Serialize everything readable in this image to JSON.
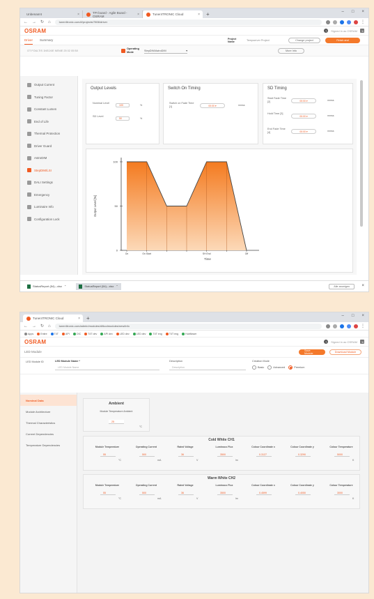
{
  "screen1": {
    "tabs": [
      {
        "label": "Unbenannt"
      },
      {
        "label": "TPI board - Agile Board - OSRAM"
      },
      {
        "label": "Tuner4TRONIC Cloud"
      }
    ],
    "url": "tuner4tronic.com/#/projects/7806/driver",
    "brand": "OSRAM",
    "signed_in": "Signed in as OSRAM",
    "subtabs": [
      "Driver",
      "Summary"
    ],
    "project_name_label": "Project Name",
    "project_name_value": "Tempserver Project",
    "change_project": "Change project",
    "finish": "Finish and",
    "device_id": "OT FOULTIS 1NS1XIE NENIE 25 02 05 BX",
    "operating_mode_label": "Operating Mode",
    "operating_mode_value": "StepDIM/AstroDIM",
    "more_info": "More Info",
    "sidebar": [
      "Output Current",
      "Tuning Factor",
      "Constant Lumen",
      "End of Life",
      "Thermal Protection",
      "Driver Guard",
      "AstroDIM",
      "StepDIM/LSI",
      "DALI Settings",
      "Emergency",
      "Luminaire Info",
      "Configuration Lock"
    ],
    "active_sidebar_index": 7,
    "output_levels": {
      "title": "Output Levels",
      "nominal_label": "Nominal Level",
      "nominal_value": "100",
      "nominal_unit": "%",
      "sd_label": "SD Level",
      "sd_value": "50",
      "sd_unit": "%"
    },
    "switch_on": {
      "title": "Switch On Timing",
      "label": "Switch on Fade Time [1]",
      "value": "00:00",
      "unit": "mmss"
    },
    "sd_timing": {
      "title": "SD Timing",
      "rows": [
        {
          "label": "Start Fade Time [2]",
          "value": "00:00",
          "unit": "mmss"
        },
        {
          "label": "Hold Time [3]",
          "value": "00:00",
          "unit": "mmss"
        },
        {
          "label": "End Fade Time [4]",
          "value": "00:00",
          "unit": "mmss"
        }
      ]
    },
    "downloads": [
      {
        "label": "StatusReport (54).-.xlsx"
      },
      {
        "label": "StatusReport (54).-.xlsx"
      }
    ],
    "show_all": "Alle anzeigen"
  },
  "chart_data": {
    "type": "area",
    "ylabel": "Output Level [%]",
    "xlabel": "Time",
    "ylim": [
      0,
      100
    ],
    "y_ticks": [
      "0",
      "50",
      "100"
    ],
    "x_tick_labels": [
      "On",
      "On Start",
      "",
      "",
      "SH End",
      "",
      "Off"
    ],
    "x": [
      0,
      1,
      2,
      3,
      4,
      5,
      6
    ],
    "y": [
      100,
      100,
      50,
      50,
      100,
      100,
      0
    ],
    "color": "#f47b20"
  },
  "screen2": {
    "tabs": [
      {
        "label": "Tuner4TRONIC Cloud"
      }
    ],
    "url": "tuner4tronic.com/admin/modules/d/tkodmodules/new/info",
    "bookmarks": [
      "Apps",
      "Entire",
      "T4T",
      "API",
      "OIC",
      "T4T dev",
      "API dev",
      "LED dev",
      "LED dev",
      "T4T eng",
      "T4T eng",
      "Hubflower"
    ],
    "brand": "OSRAM",
    "signed_in": "Signed in as OSRAM",
    "breadcrumb": "LED Module",
    "save_module": "Save Module",
    "download_module": "Download Module",
    "led_module_id_label": "LED Module ID",
    "led_module_name_label": "LED Module Name *",
    "led_module_name_placeholder": "LED Module Name",
    "description_label": "Description",
    "description_placeholder": "Description",
    "creation_mode_label": "Creation Mode",
    "creation_modes": [
      "Basic",
      "Advanced",
      "Premium"
    ],
    "creation_mode_selected": 2,
    "sidebar": [
      "Nominal Data",
      "Module Architecture",
      "Thermal Characteristics",
      "Current Dependencies",
      "Temperature Dependencies"
    ],
    "active_sidebar_index": 0,
    "ambient": {
      "title": "Ambient",
      "label": "Module Temperature Ambient",
      "value": "25",
      "unit": "°C"
    },
    "columns": [
      "Module Temperature",
      "Operating Current",
      "Rated Voltage",
      "Luminous Flux",
      "Colour Coordinate x",
      "Colour Coordinate y",
      "Colour Temperature"
    ],
    "cold_white": {
      "title": "Cold White CH1",
      "values": [
        "55",
        "500",
        "36",
        "3500",
        "0.3127",
        "0.3290",
        "5000"
      ],
      "units": [
        "°C",
        "mA",
        "V",
        "lm",
        "",
        "",
        "K"
      ]
    },
    "warm_white": {
      "title": "Warm White CH2",
      "values": [
        "55",
        "500",
        "36",
        "3500",
        "0.4599",
        "0.4050",
        "3000"
      ],
      "units": [
        "°C",
        "mA",
        "V",
        "lm",
        "",
        "",
        "K"
      ]
    }
  }
}
